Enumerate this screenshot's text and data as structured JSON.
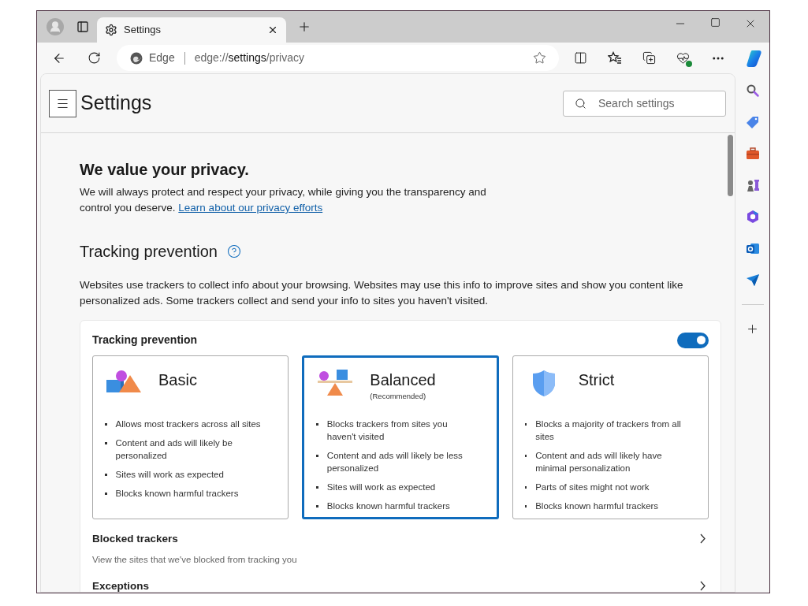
{
  "tab": {
    "title": "Settings"
  },
  "address_bar": {
    "brand": "Edge",
    "url": [
      {
        "text": "edge://",
        "emphasis": false
      },
      {
        "text": "settings",
        "emphasis": true
      },
      {
        "text": "/privacy",
        "emphasis": false
      }
    ]
  },
  "header": {
    "title": "Settings",
    "search": {
      "placeholder": "Search settings"
    }
  },
  "intro": {
    "title": "We value your privacy.",
    "text": "We will always protect and respect your privacy, while giving you the transparency and control you deserve.",
    "link": "Learn about our privacy efforts"
  },
  "tracking": {
    "title": "Tracking prevention",
    "description": "Websites use trackers to collect info about your browsing. Websites may use this info to improve sites and show you content like personalized ads. Some trackers collect and send your info to sites you haven't visited.",
    "card_title": "Tracking prevention",
    "on": true,
    "levels": [
      {
        "kind": "basic",
        "title": "Basic",
        "selected": false,
        "points": [
          "Allows most trackers across all sites",
          "Content and ads will likely be personalized",
          "Sites will work as expected",
          "Blocks known harmful trackers"
        ]
      },
      {
        "kind": "balanced",
        "title": "Balanced",
        "subtitle": "(Recommended)",
        "selected": true,
        "points": [
          "Blocks trackers from sites you haven't visited",
          "Content and ads will likely be less personalized",
          "Sites will work as expected",
          "Blocks known harmful trackers"
        ]
      },
      {
        "kind": "strict",
        "title": "Strict",
        "selected": false,
        "points": [
          "Blocks a majority of trackers from all sites",
          "Content and ads will likely have minimal personalization",
          "Parts of sites might not work",
          "Blocks known harmful trackers"
        ]
      }
    ],
    "rows": [
      {
        "title": "Blocked trackers",
        "description": "View the sites that we've blocked from tracking you"
      },
      {
        "title": "Exceptions"
      }
    ]
  }
}
